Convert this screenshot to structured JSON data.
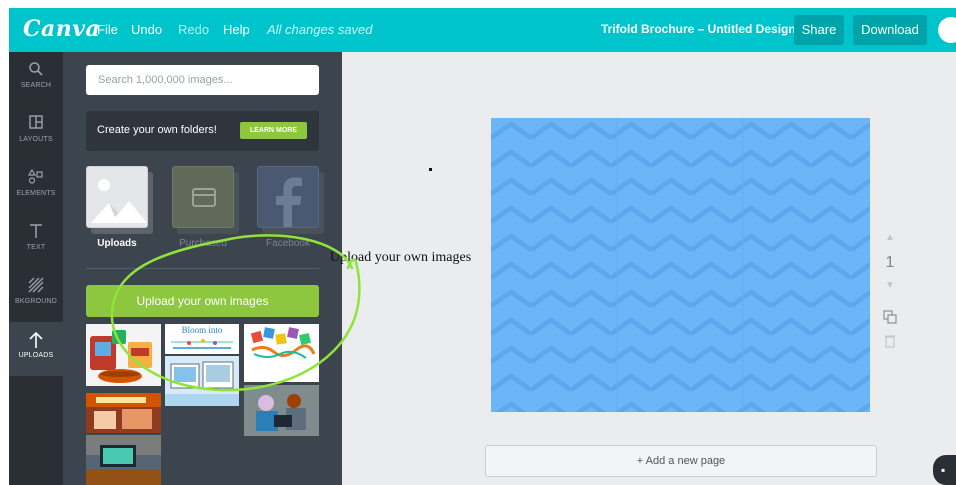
{
  "app": {
    "logo": "Canva",
    "menu": [
      "File",
      "Undo",
      "Redo",
      "Help"
    ],
    "save_status": "All changes saved",
    "document_title": "Trifold Brochure – Untitled Design",
    "share_label": "Share",
    "download_label": "Download",
    "accent_color": "#00c4cc"
  },
  "rail": {
    "items": [
      {
        "label": "SEARCH",
        "icon": "search-icon"
      },
      {
        "label": "LAYOUTS",
        "icon": "layouts-icon"
      },
      {
        "label": "ELEMENTS",
        "icon": "elements-icon"
      },
      {
        "label": "TEXT",
        "icon": "text-icon"
      },
      {
        "label": "BKGROUND",
        "icon": "background-icon"
      },
      {
        "label": "UPLOADS",
        "icon": "upload-arrow-icon"
      }
    ],
    "active": "UPLOADS"
  },
  "panel": {
    "search_placeholder": "Search 1,000,000 images...",
    "folders_text": "Create your own folders!",
    "learn_more": "LEARN MORE",
    "tabs": [
      {
        "label": "Uploads",
        "state": "active"
      },
      {
        "label": "Purchased",
        "state": "inactive"
      },
      {
        "label": "Facebook",
        "state": "inactive"
      }
    ],
    "upload_button": "Upload your own images",
    "thumbnails": [
      "snack-food-image",
      "bloom-into-flyer-image",
      "colorful-letters-image",
      "classroom-poster-image",
      "computer-screen-image",
      "kids-at-computers-image",
      "classroom-desk-image"
    ],
    "thumb_text_bloom": "Bloom into"
  },
  "canvas": {
    "page_number": "1",
    "add_page": "+ Add a new page",
    "background_color": "#6cb6f8"
  },
  "annotation": {
    "text": "Upload your own images",
    "color": "#8fe33a"
  }
}
